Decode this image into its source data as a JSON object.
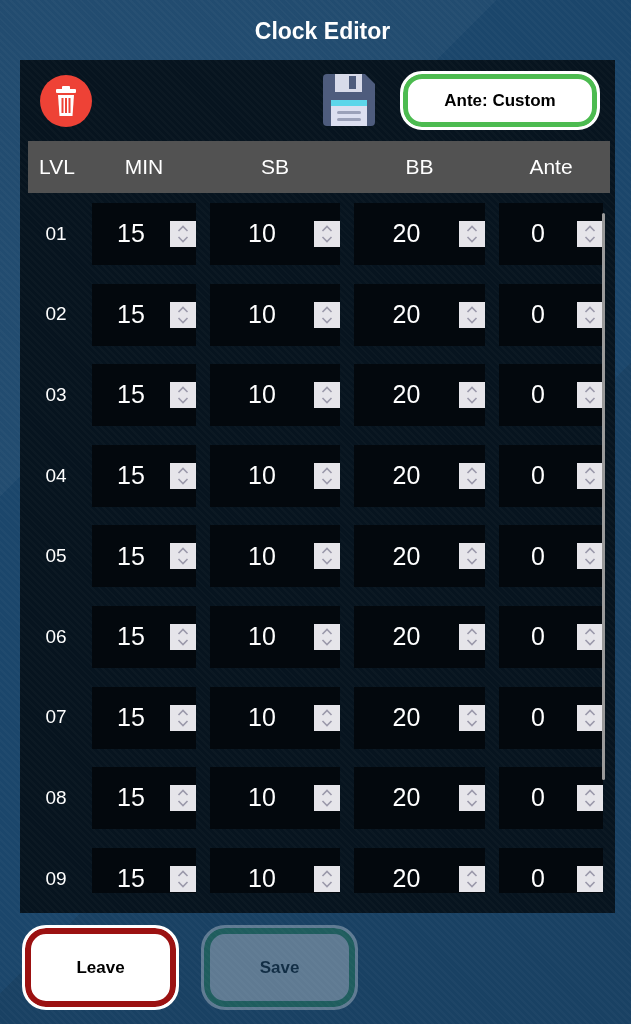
{
  "window": {
    "title": "Clock Editor"
  },
  "toolbar": {
    "ante_button": {
      "label": "Ante: Custom"
    }
  },
  "table": {
    "columns": [
      "LVL",
      "MIN",
      "SB",
      "BB",
      "Ante"
    ],
    "rows": [
      {
        "cells": [
          "01",
          "15",
          "10",
          "20",
          "0"
        ]
      },
      {
        "cells": [
          "02",
          "15",
          "10",
          "20",
          "0"
        ]
      },
      {
        "cells": [
          "03",
          "15",
          "10",
          "20",
          "0"
        ]
      },
      {
        "cells": [
          "04",
          "15",
          "10",
          "20",
          "0"
        ]
      },
      {
        "cells": [
          "05",
          "15",
          "10",
          "20",
          "0"
        ]
      },
      {
        "cells": [
          "06",
          "15",
          "10",
          "20",
          "0"
        ]
      },
      {
        "cells": [
          "07",
          "15",
          "10",
          "20",
          "0"
        ]
      },
      {
        "cells": [
          "08",
          "15",
          "10",
          "20",
          "0"
        ]
      },
      {
        "cells": [
          "09",
          "15",
          "10",
          "20",
          "0"
        ]
      }
    ]
  },
  "buttons": [
    {
      "label": "Leave",
      "kind": "leave",
      "disabled": false
    },
    {
      "label": "Save",
      "kind": "save",
      "disabled": true
    }
  ]
}
